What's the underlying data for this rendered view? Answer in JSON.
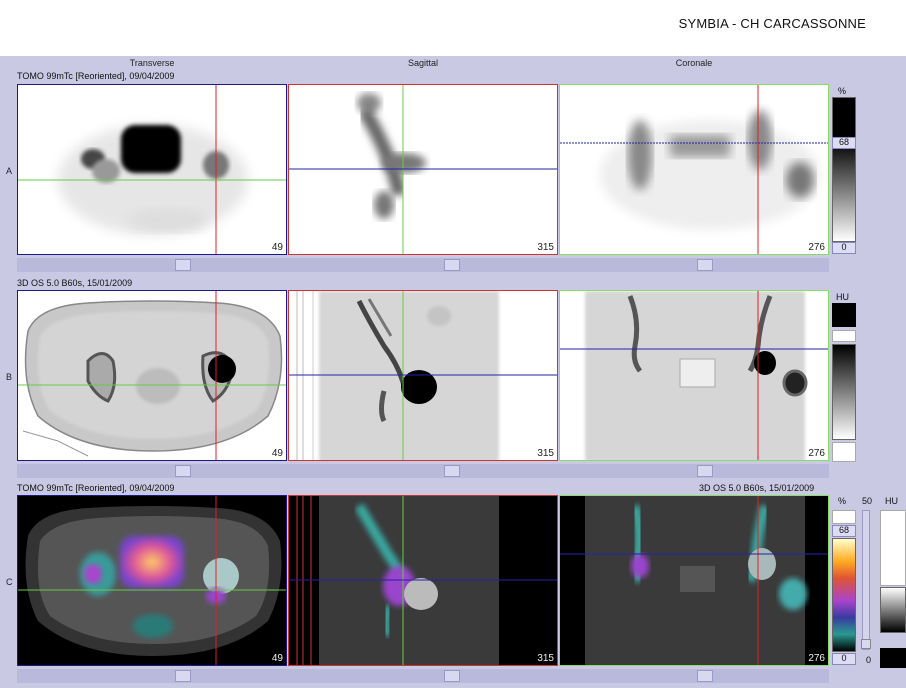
{
  "header": {
    "site": "SYMBIA - CH CARCASSONNE"
  },
  "columns": [
    "Transverse",
    "Sagittal",
    "Coronale"
  ],
  "rows": {
    "A": {
      "label": "A",
      "info": "TOMO 99mTc [Reoriented], 09/04/2009",
      "scale": {
        "unit": "%",
        "max": "68",
        "min": "0"
      }
    },
    "B": {
      "label": "B",
      "info": "3D  OS  5.0  B60s, 15/01/2009",
      "scale": {
        "unit": "HU"
      }
    },
    "C": {
      "label": "C",
      "info_left": "TOMO 99mTc [Reoriented], 09/04/2009",
      "info_right": "3D  OS  5.0  B60s, 15/01/2009",
      "scale": {
        "unit": "%",
        "max": "68",
        "min": "0",
        "slider_value": "50",
        "slider_min": "0",
        "unit2": "HU"
      }
    }
  },
  "slices": {
    "transverse": "49",
    "sagittal": "315",
    "coronale": "276"
  },
  "colors": {
    "transverse_border": "#1a1a8a",
    "sagittal_border": "#cc3333",
    "coronale_border": "#88dd66",
    "crosshair_v": "#dd2222",
    "crosshair_h_green": "#66cc44",
    "crosshair_h_blue": "#2222aa"
  }
}
